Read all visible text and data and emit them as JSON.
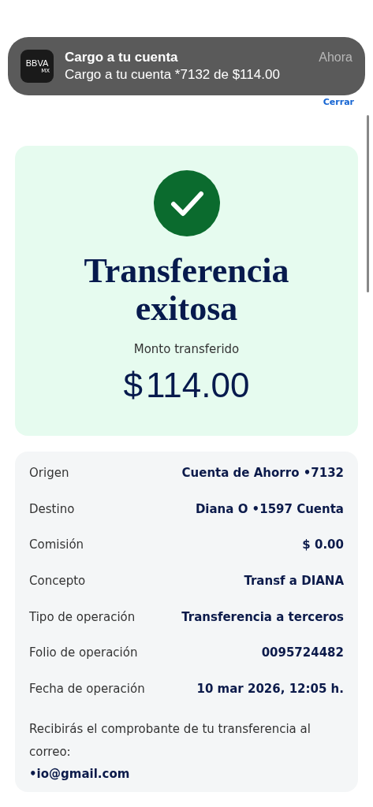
{
  "notification": {
    "app_logo": "BBVA",
    "app_logo_sub": "MX",
    "title": "Cargo a tu cuenta",
    "time": "Ahora",
    "body": "Cargo a tu cuenta *7132 de $114.00"
  },
  "header": {
    "close_link": "Cerrar"
  },
  "success": {
    "title": "Transferencia exitosa",
    "amount_label": "Monto transferido",
    "amount_currency": "$",
    "amount": "114.00"
  },
  "details": [
    {
      "label": "Origen",
      "value": "Cuenta de Ahorro •7132"
    },
    {
      "label": "Destino",
      "value": "Diana O •1597 Cuenta"
    },
    {
      "label": "Comisión",
      "value": "$ 0.00"
    },
    {
      "label": "Concepto",
      "value": "Transf a DIANA"
    },
    {
      "label": "Tipo de operación",
      "value": "Transferencia a terceros"
    },
    {
      "label": "Folio de operación",
      "value": "0095724482"
    },
    {
      "label": "Fecha de operación",
      "value": "10 mar 2026, 12:05 h."
    }
  ],
  "receipt": {
    "message": "Recibirás el comprobante de tu transferencia al correo:",
    "email": "•io@gmail.com"
  }
}
